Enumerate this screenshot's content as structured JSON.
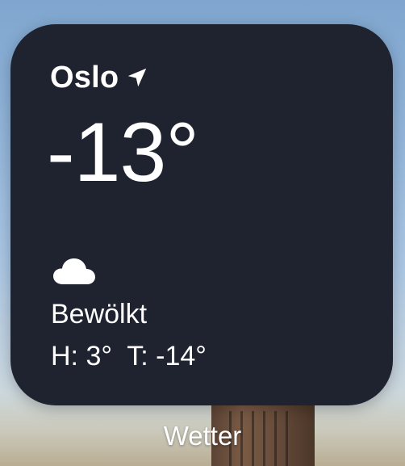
{
  "widget": {
    "city": "Oslo",
    "location_icon": "location-arrow-icon",
    "temperature": "-13°",
    "condition_icon": "cloud-icon",
    "condition": "Bewölkt",
    "high_low": "H: 3°  T: -14°",
    "background_color": "#1f2330",
    "text_color": "#ffffff"
  },
  "app_label": "Wetter"
}
